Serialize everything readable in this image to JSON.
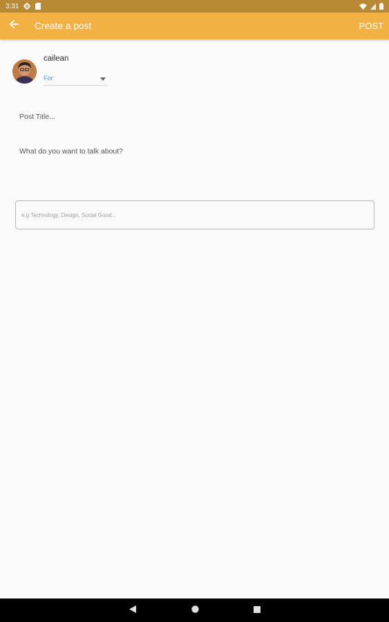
{
  "status_bar": {
    "time": "3:31",
    "left_icons": [
      "gear-icon",
      "sd-card-icon"
    ],
    "right_icons": [
      "wifi-icon",
      "signal-icon",
      "battery-icon"
    ]
  },
  "app_bar": {
    "title": "Create a post",
    "action_label": "POST",
    "background_color": "#f4b143"
  },
  "author": {
    "username": "cailean",
    "audience_label": "For:",
    "audience_value": ""
  },
  "form": {
    "title_placeholder": "Post Title...",
    "body_placeholder": "What do you want to talk about?",
    "tags_placeholder": "e.g Technology, Design, Social Good..."
  },
  "nav_bar": {
    "buttons": [
      "back-triangle-icon",
      "home-circle-icon",
      "recents-square-icon"
    ]
  },
  "colors": {
    "status_bar": "#b98a36",
    "accent": "#f4b143",
    "link_blue": "#4a90e2"
  }
}
